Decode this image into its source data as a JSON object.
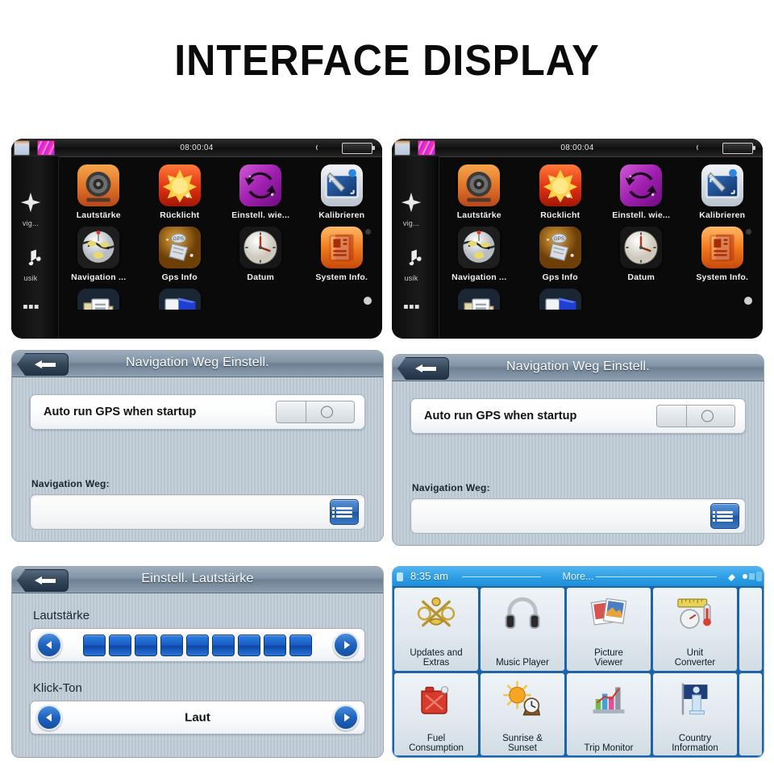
{
  "page": {
    "title": "INTERFACE DISPLAY",
    "background": "#ffffff",
    "accent_blue": "#1f62bd",
    "header_blue_gray": "#7e90a2",
    "garmin_blue": "#2d9fe6"
  },
  "device_home": {
    "status_bar": {
      "time": "08:00:04",
      "signal_icon": "signal-waves-icon",
      "battery_icon": "battery-icon",
      "left_icon_1": "screen-icon",
      "left_icon_2": "gradient-tile-icon"
    },
    "sidebar": [
      {
        "icon": "compass-icon",
        "label": "vig..."
      },
      {
        "icon": "music-note-icon",
        "label": "usik"
      },
      {
        "icon": "grid-apps-icon",
        "label": ""
      }
    ],
    "rows": [
      [
        {
          "label": "Lautstärke",
          "icon": "speaker-icon"
        },
        {
          "label": "Rücklicht",
          "icon": "sun-brightness-icon"
        },
        {
          "label": "Einstell. wie...",
          "icon": "restore-refresh-icon"
        },
        {
          "label": "Kalibrieren",
          "icon": "screen-calibrate-icon"
        }
      ],
      [
        {
          "label": "Navigation ...",
          "icon": "navigation-path-icon"
        },
        {
          "label": "Gps Info",
          "icon": "gps-info-icon"
        },
        {
          "label": "Datum",
          "icon": "clock-date-icon"
        },
        {
          "label": "System Info.",
          "icon": "system-info-icon"
        }
      ],
      [
        {
          "label": "",
          "icon": "file-folder-icon"
        },
        {
          "label": "",
          "icon": "blue-book-icon"
        }
      ]
    ]
  },
  "nav_settings": {
    "title": "Navigation Weg Einstell.",
    "back_icon": "back-arrow-icon",
    "auto_run_label": "Auto run GPS when startup",
    "auto_run_state": "off",
    "path_label": "Navigation Weg:",
    "path_value": "",
    "path_placeholder": "",
    "browse_icon": "list-icon"
  },
  "volume_settings": {
    "title": "Einstell. Lautstärke",
    "back_icon": "back-arrow-icon",
    "volume_label": "Lautstärke",
    "volume_level": 9,
    "volume_max": 9,
    "click_tone_label": "Klick-Ton",
    "click_tone_value": "Laut",
    "prev_icon": "chevron-left-icon",
    "next_icon": "chevron-right-icon"
  },
  "more_menu": {
    "time": "8:35 am",
    "title": "More...",
    "satellite_icon": "satellite-icon",
    "battery_icon": "battery-icon",
    "tiles": [
      {
        "label_line1": "Updates and",
        "label_line2": "Extras",
        "icon": "updates-extras-icon"
      },
      {
        "label_line1": "Music Player",
        "label_line2": "",
        "icon": "headphones-icon"
      },
      {
        "label_line1": "Picture",
        "label_line2": "Viewer",
        "icon": "photos-icon"
      },
      {
        "label_line1": "Unit",
        "label_line2": "Converter",
        "icon": "unit-converter-icon"
      },
      {
        "label_line1": "Fuel",
        "label_line2": "Consumption",
        "icon": "fuel-can-icon"
      },
      {
        "label_line1": "Sunrise &",
        "label_line2": "Sunset",
        "icon": "sunrise-sunset-icon"
      },
      {
        "label_line1": "Trip Monitor",
        "label_line2": "",
        "icon": "bar-chart-icon"
      },
      {
        "label_line1": "Country",
        "label_line2": "Information",
        "icon": "country-flag-icon"
      }
    ]
  }
}
